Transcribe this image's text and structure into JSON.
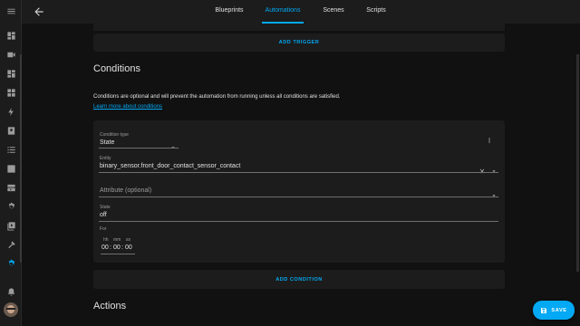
{
  "nav": {
    "tabs": [
      {
        "label": "Blueprints"
      },
      {
        "label": "Automations"
      },
      {
        "label": "Scenes"
      },
      {
        "label": "Scripts"
      }
    ]
  },
  "triggers": {
    "add_label": "ADD TRIGGER"
  },
  "conditions": {
    "heading": "Conditions",
    "description": "Conditions are optional and will prevent the automation from running unless all conditions are satisfied.",
    "learn_more": "Learn more about conditions",
    "condition_type_label": "Condition type",
    "condition_type_value": "State",
    "entity_label": "Entity",
    "entity_value": "binary_sensor.front_door_contact_sensor_contact",
    "attribute_placeholder": "Attribute (optional)",
    "state_label": "State",
    "state_value": "off",
    "for_label": "For",
    "for_units": {
      "hh": "hh",
      "mm": "mm",
      "ss": "ss"
    },
    "for_values": {
      "hh": "00",
      "mm": "00",
      "ss": "00"
    },
    "colon": ":",
    "add_label": "ADD CONDITION"
  },
  "actions": {
    "heading": "Actions"
  },
  "fab": {
    "save_label": "SAVE"
  },
  "colors": {
    "accent": "#03a9f4",
    "background": "#111111",
    "card": "#1c1c1c"
  }
}
